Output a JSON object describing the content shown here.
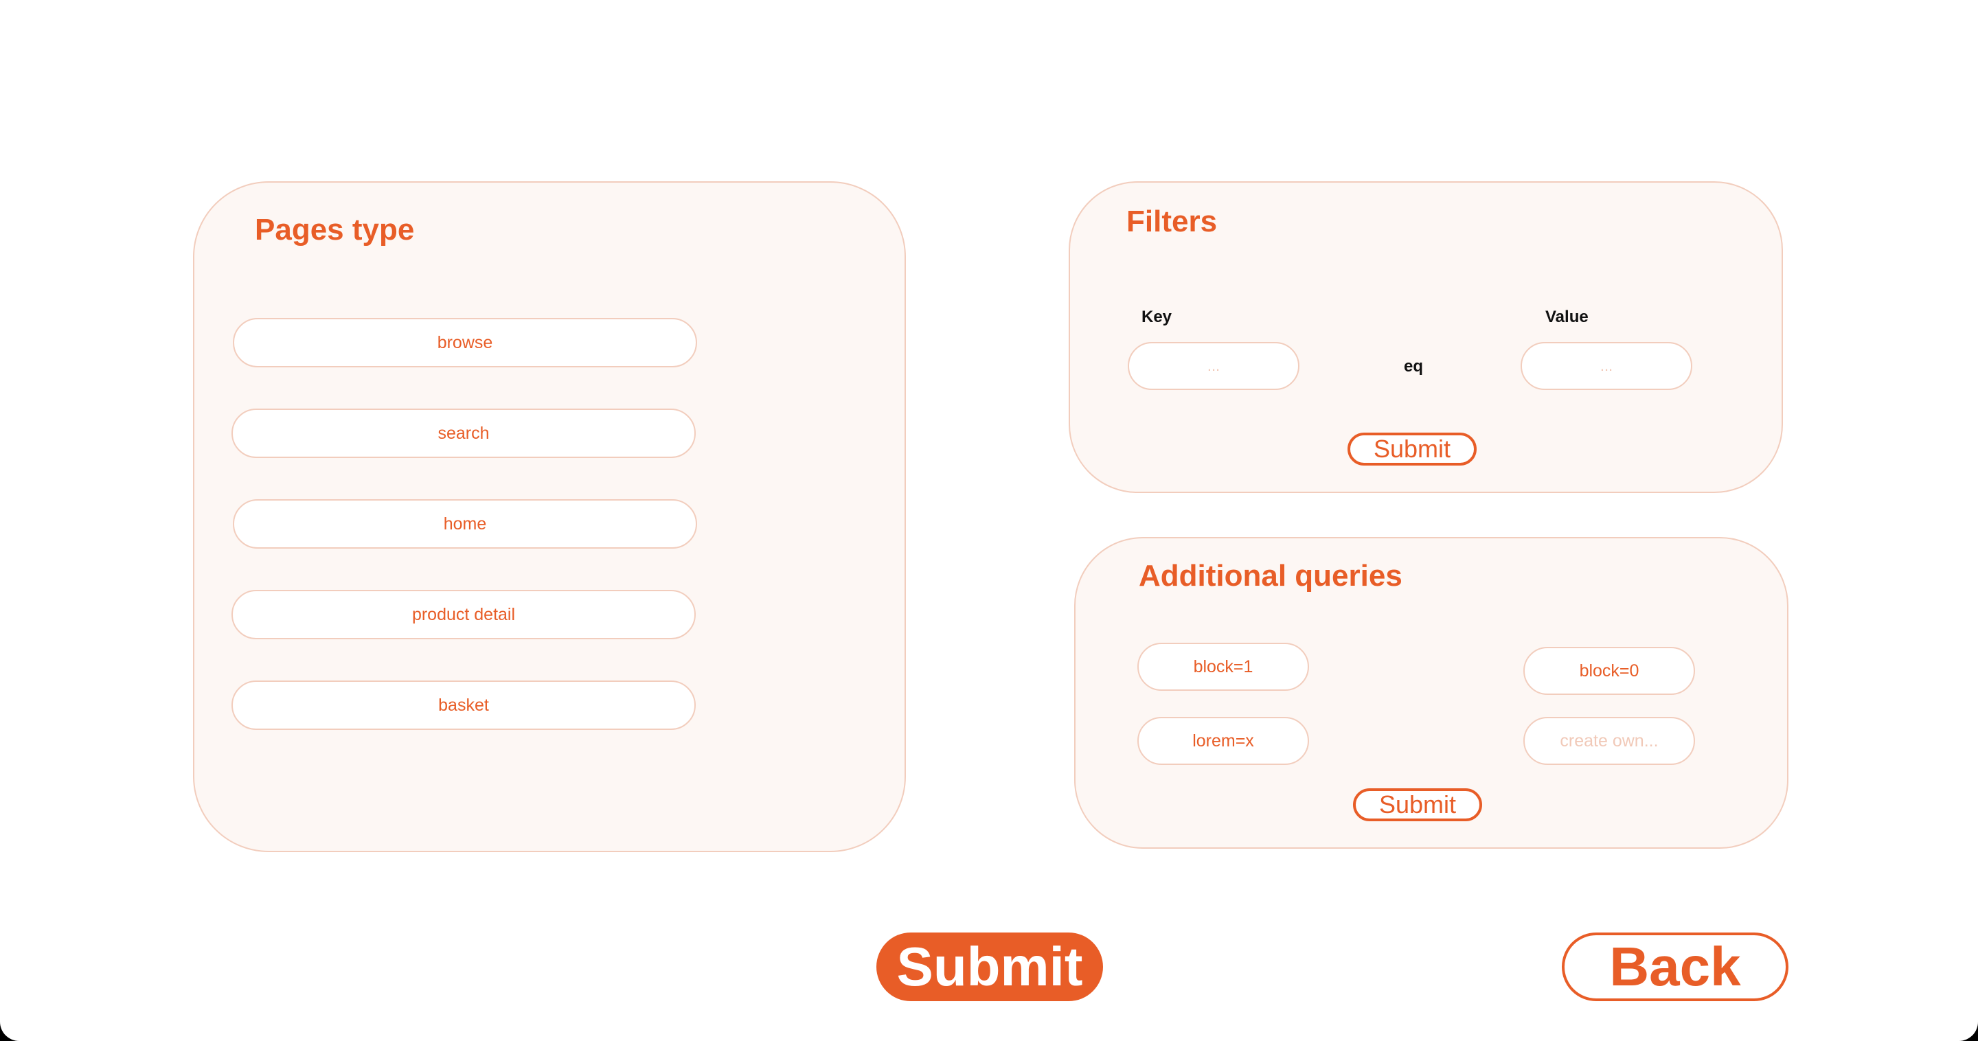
{
  "colors": {
    "accent": "#e85d27",
    "panel_bg": "#fdf7f4",
    "border": "#f2cdbd",
    "placeholder": "#f1c9b8"
  },
  "pages_type": {
    "title": "Pages type",
    "items": [
      {
        "label": "browse"
      },
      {
        "label": "search"
      },
      {
        "label": "home"
      },
      {
        "label": "product detail"
      },
      {
        "label": "basket"
      }
    ]
  },
  "filters": {
    "title": "Filters",
    "key_label": "Key",
    "value_label": "Value",
    "operator": "eq",
    "key_placeholder": "...",
    "value_placeholder": "...",
    "submit_label": "Submit"
  },
  "additional_queries": {
    "title": "Additional queries",
    "items": [
      {
        "label": "block=1"
      },
      {
        "label": "block=0"
      },
      {
        "label": "lorem=x"
      },
      {
        "label": "create own..."
      }
    ],
    "submit_label": "Submit"
  },
  "actions": {
    "submit_label": "Submit",
    "back_label": "Back"
  }
}
